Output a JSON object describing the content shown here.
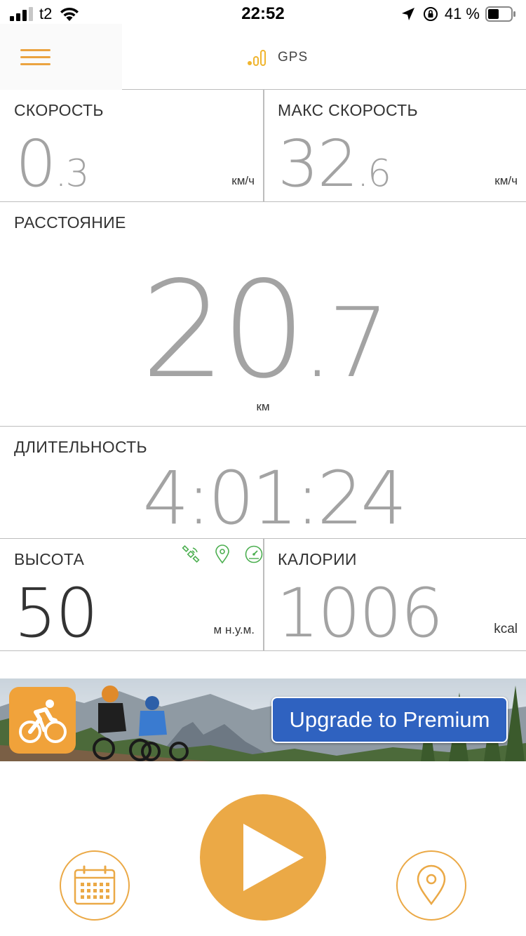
{
  "status_bar": {
    "carrier": "t2",
    "time": "22:52",
    "battery_percent": "41 %"
  },
  "topbar": {
    "gps_label": "GPS"
  },
  "speed": {
    "label": "СКОРОСТЬ",
    "value_int": "0",
    "value_dec": ".3",
    "unit": "км/ч"
  },
  "max_speed": {
    "label": "МАКС СКОРОСТЬ",
    "value_int": "32",
    "value_dec": ".6",
    "unit": "км/ч"
  },
  "distance": {
    "label": "РАССТОЯНИЕ",
    "value_int": "20",
    "value_dec": ".7",
    "unit": "км"
  },
  "duration": {
    "label": "ДЛИТЕЛЬНОСТЬ",
    "value": "4:01:24"
  },
  "altitude": {
    "label": "ВЫСОТА",
    "value": "50",
    "unit": "м н.у.м."
  },
  "calories": {
    "label": "КАЛОРИИ",
    "value": "1006",
    "unit": "kcal"
  },
  "banner": {
    "upgrade_label": "Upgrade to Premium"
  },
  "colors": {
    "accent": "#EBA946",
    "premium_button": "#2F62C0",
    "value_gray": "#A3A3A3",
    "altitude_value": "#333333",
    "source_icons_green": "#4CAF50"
  },
  "icons": [
    "menu-icon",
    "gps-signal-icon",
    "satellite-icon",
    "location-pin-icon",
    "speedometer-icon",
    "cyclist-icon",
    "play-icon",
    "calendar-icon",
    "map-pin-icon"
  ]
}
